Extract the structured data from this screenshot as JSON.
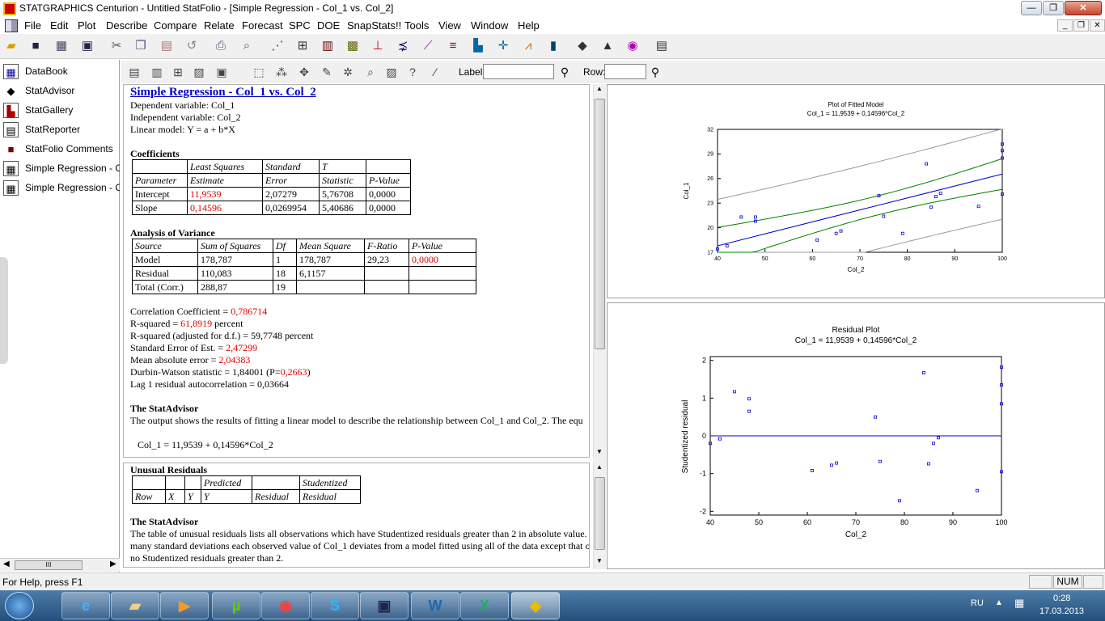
{
  "window": {
    "title": "STATGRAPHICS Centurion - Untitled StatFolio - [Simple Regression - Col_1 vs. Col_2]"
  },
  "menu": [
    "File",
    "Edit",
    "Plot",
    "Describe",
    "Compare",
    "Relate",
    "Forecast",
    "SPC",
    "DOE",
    "SnapStats!!",
    "Tools",
    "View",
    "Window",
    "Help"
  ],
  "sidebar": {
    "items": [
      {
        "label": "DataBook",
        "icon": "grid"
      },
      {
        "label": "StatAdvisor",
        "icon": "diamond"
      },
      {
        "label": "StatGallery",
        "icon": "gallery"
      },
      {
        "label": "StatReporter",
        "icon": "report"
      },
      {
        "label": "StatFolio Comments",
        "icon": "book"
      },
      {
        "label": "Simple Regression - Col_",
        "icon": "table"
      },
      {
        "label": "Simple Regression - Col_",
        "icon": "table"
      }
    ],
    "scroll_thumb": "III"
  },
  "toolbar2": {
    "label_caption": "Label:",
    "row_caption": "Row:"
  },
  "report": {
    "title": "Simple Regression - Col_1 vs. Col_2",
    "dependent": "Dependent variable: Col_1",
    "independent": "Independent variable: Col_2",
    "model": "Linear model: Y = a + b*X",
    "coef_heading": "Coefficients",
    "coef_header1": [
      "",
      "Least Squares",
      "Standard",
      "T",
      ""
    ],
    "coef_header2": [
      "Parameter",
      "Estimate",
      "Error",
      "Statistic",
      "P-Value"
    ],
    "coef_rows": [
      [
        "Intercept",
        "11,9539",
        "2,07279",
        "5,76708",
        "0,0000"
      ],
      [
        "Slope",
        "0,14596",
        "0,0269954",
        "5,40686",
        "0,0000"
      ]
    ],
    "anova_heading": "Analysis of Variance",
    "anova_header": [
      "Source",
      "Sum of Squares",
      "Df",
      "Mean Square",
      "F-Ratio",
      "P-Value"
    ],
    "anova_rows": [
      [
        "Model",
        "178,787",
        "1",
        "178,787",
        "29,23",
        "0,0000"
      ],
      [
        "Residual",
        "110,083",
        "18",
        "6,1157",
        "",
        ""
      ],
      [
        "Total (Corr.)",
        "288,87",
        "19",
        "",
        "",
        ""
      ]
    ],
    "stats": {
      "corr_label": "Correlation Coefficient = ",
      "corr_value": "0,786714",
      "r2_label": "R-squared = ",
      "r2_value": "61,8919",
      "r2_suffix": " percent",
      "r2adj": "R-squared (adjusted for d.f.) = 59,7748 percent",
      "see_label": "Standard Error of Est. = ",
      "see_value": "2,47299",
      "mae_label": "Mean absolute error = ",
      "mae_value": "2,04383",
      "dw_label": "Durbin-Watson statistic = 1,84001 (P=",
      "dw_value": "0,2663",
      "dw_suffix": ")",
      "lag": "Lag 1 residual autocorrelation = 0,03664"
    },
    "advisor_heading": "The StatAdvisor",
    "advisor_text": "The output shows the results of fitting a linear model to describe the relationship between Col_1 and Col_2.  The equ",
    "equation": "Col_1 = 11,9539 + 0,14596*Col_2"
  },
  "report2": {
    "heading": "Unusual Residuals",
    "header1": [
      "",
      "",
      "",
      "Predicted",
      "",
      "Studentized"
    ],
    "header2": [
      "Row",
      "X",
      "Y",
      "Y",
      "Residual",
      "Residual"
    ],
    "advisor_heading": "The StatAdvisor",
    "advisor_lines": [
      "The table of unusual residuals lists all observations which have Studentized residuals greater than 2 in absolute value.",
      "many standard deviations each observed value of Col_1 deviates from a model fitted using all of the data except that o",
      "no Studentized residuals greater than 2."
    ]
  },
  "chart_data": [
    {
      "type": "scatter",
      "title": "Plot of Fitted Model",
      "subtitle": "Col_1 = 11,9539 + 0,14596*Col_2",
      "xlabel": "Col_2",
      "ylabel": "Col_1",
      "xlim": [
        40,
        100
      ],
      "ylim": [
        17,
        32
      ],
      "xticks": [
        "40",
        "50",
        "60",
        "70",
        "80",
        "90",
        "100"
      ],
      "yticks": [
        "17",
        "20",
        "23",
        "26",
        "29",
        "32"
      ],
      "points": [
        [
          40,
          17.4
        ],
        [
          42,
          17.8
        ],
        [
          45,
          21.3
        ],
        [
          48,
          21.3
        ],
        [
          48,
          20.8
        ],
        [
          61,
          18.5
        ],
        [
          65,
          19.3
        ],
        [
          66,
          19.6
        ],
        [
          74,
          23.9
        ],
        [
          75,
          21.4
        ],
        [
          79,
          19.3
        ],
        [
          84,
          27.8
        ],
        [
          85,
          22.5
        ],
        [
          86,
          23.8
        ],
        [
          87,
          24.2
        ],
        [
          95,
          22.6
        ],
        [
          100,
          30.2
        ],
        [
          100,
          29.4
        ],
        [
          100,
          28.5
        ],
        [
          100,
          24.1
        ]
      ],
      "fit": {
        "intercept": 11.9539,
        "slope": 0.14596
      },
      "colors": {
        "points": "#0000cc",
        "fit": "#0000cc",
        "confidence": "#008000",
        "prediction": "#999999"
      }
    },
    {
      "type": "scatter",
      "title": "Residual Plot",
      "subtitle": "Col_1 = 11,9539 + 0,14596*Col_2",
      "xlabel": "Col_2",
      "ylabel": "Studentized residual",
      "xlim": [
        40,
        100
      ],
      "ylim": [
        -2.1,
        2.1
      ],
      "xticks": [
        "40",
        "50",
        "60",
        "70",
        "80",
        "90",
        "100"
      ],
      "yticks": [
        "-2",
        "-1",
        "0",
        "1",
        "2"
      ],
      "points": [
        [
          40,
          -0.2
        ],
        [
          42,
          -0.08
        ],
        [
          45,
          1.17
        ],
        [
          48,
          0.98
        ],
        [
          48,
          0.65
        ],
        [
          61,
          -0.92
        ],
        [
          65,
          -0.78
        ],
        [
          66,
          -0.72
        ],
        [
          74,
          0.5
        ],
        [
          75,
          -0.68
        ],
        [
          79,
          -1.72
        ],
        [
          84,
          1.67
        ],
        [
          85,
          -0.74
        ],
        [
          86,
          -0.2
        ],
        [
          87,
          -0.05
        ],
        [
          95,
          -1.45
        ],
        [
          100,
          1.82
        ],
        [
          100,
          1.35
        ],
        [
          100,
          0.85
        ],
        [
          100,
          -0.95
        ]
      ],
      "colors": {
        "points": "#0000cc",
        "zero_line": "#0000cc"
      }
    }
  ],
  "status": {
    "help": "For Help, press F1",
    "num": "NUM"
  },
  "taskbar": {
    "lang": "RU",
    "time": "0:28",
    "date": "17.03.2013"
  }
}
